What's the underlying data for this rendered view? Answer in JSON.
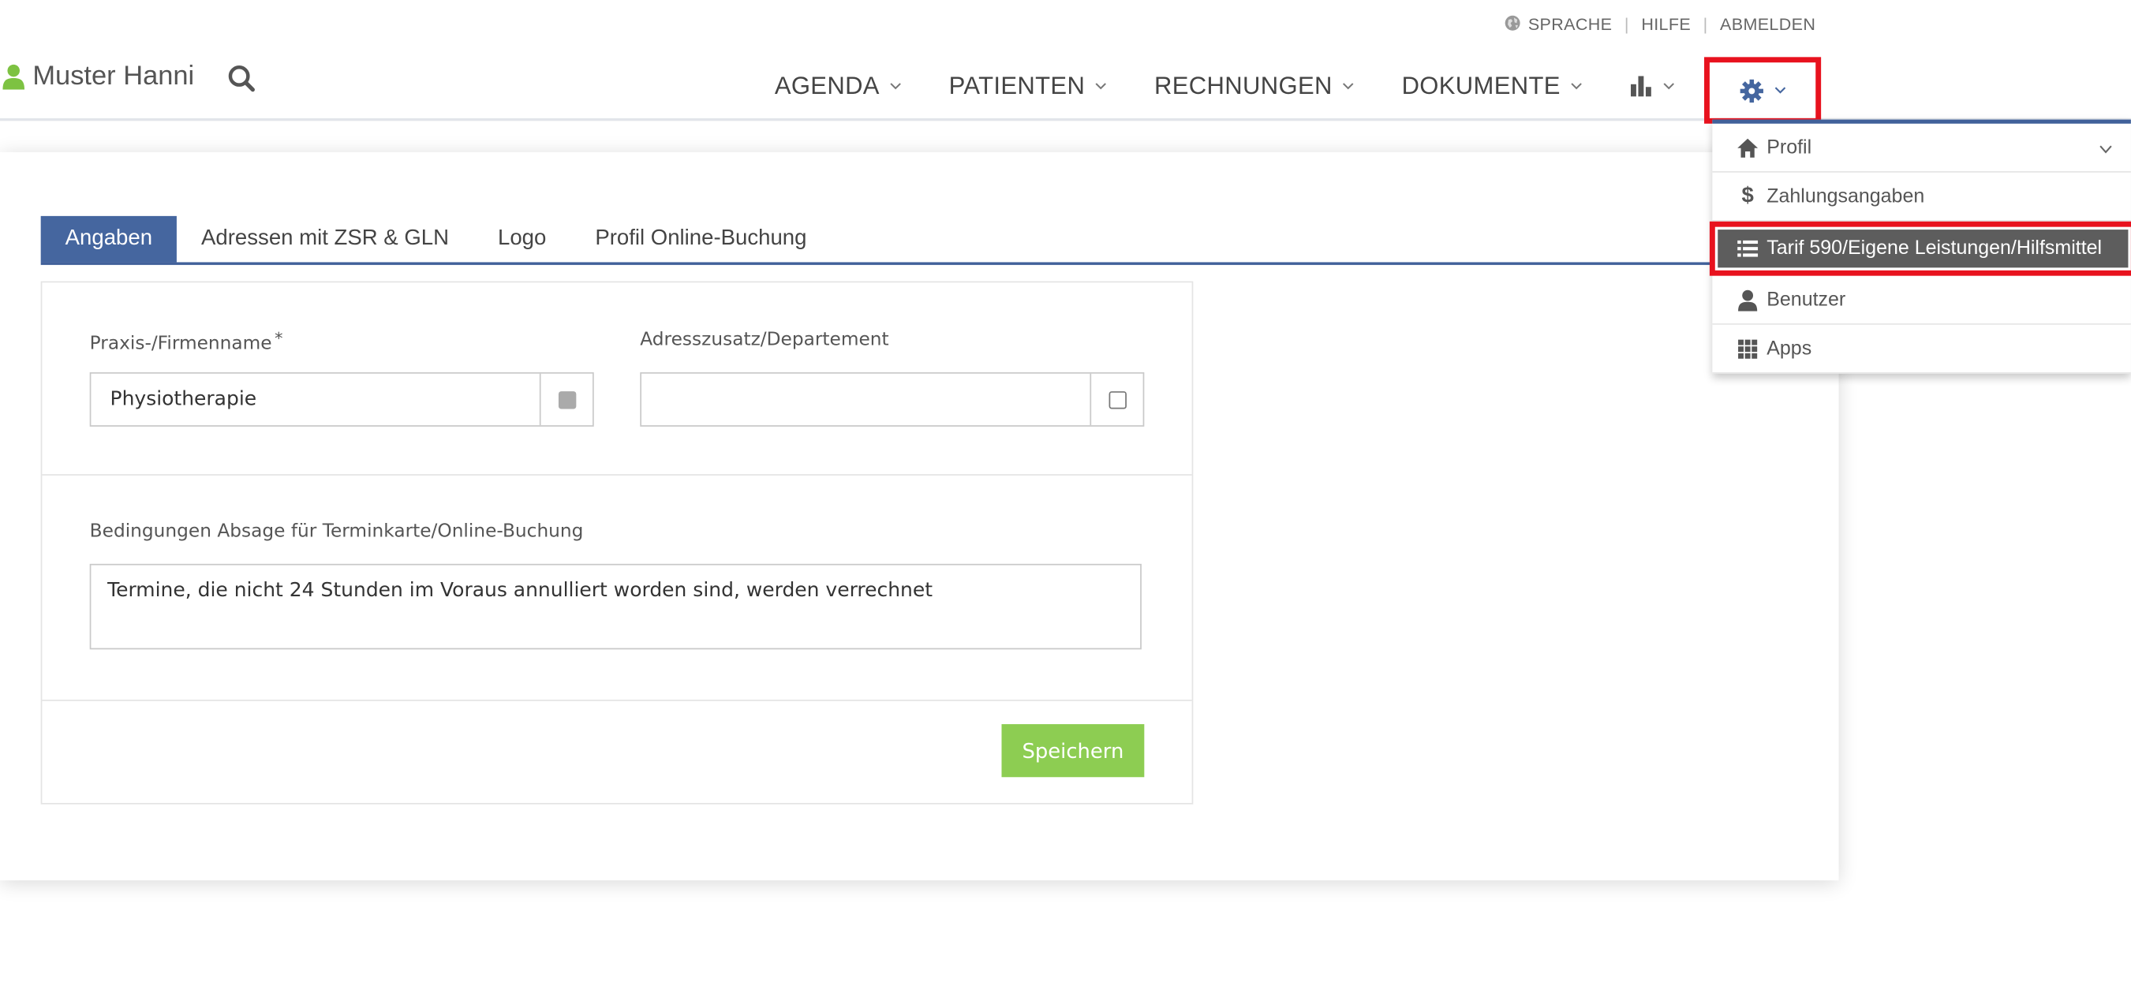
{
  "util": {
    "sprache": "SPRACHE",
    "hilfe": "HILFE",
    "abmelden": "ABMELDEN"
  },
  "user": {
    "name": "Muster Hanni"
  },
  "nav": {
    "agenda": "AGENDA",
    "patienten": "PATIENTEN",
    "rechnungen": "RECHNUNGEN",
    "dokumente": "DOKUMENTE"
  },
  "settings_menu": {
    "items": [
      {
        "label": "Profil",
        "icon": "home-icon"
      },
      {
        "label": "Zahlungsangaben",
        "icon": "dollar-icon"
      },
      {
        "label": "Tarif 590/Eigene Leistungen/Hilfsmittel",
        "icon": "list-icon",
        "active": true
      },
      {
        "label": "Benutzer",
        "icon": "user-icon"
      },
      {
        "label": "Apps",
        "icon": "grid-icon"
      }
    ]
  },
  "tabs": [
    {
      "label": "Angaben",
      "active": true
    },
    {
      "label": "Adressen mit ZSR & GLN"
    },
    {
      "label": "Logo"
    },
    {
      "label": "Profil Online-Buchung"
    }
  ],
  "form": {
    "company_label": "Praxis-/Firmenname",
    "required_mark": "*",
    "company_value": "Physiotherapie",
    "address_label": "Adresszusatz/Departement",
    "address_value": "",
    "conditions_label": "Bedingungen Absage für Terminkarte/Online-Buchung",
    "conditions_value": "Termine, die nicht 24 Stunden im Voraus annulliert worden sind, werden verrechnet",
    "save_label": "Speichern"
  },
  "colors": {
    "accent": "#45669f",
    "user_icon": "#7dc242",
    "save": "#8dcd52",
    "highlight": "#e8121e",
    "active_item": "#5d5d5d"
  }
}
